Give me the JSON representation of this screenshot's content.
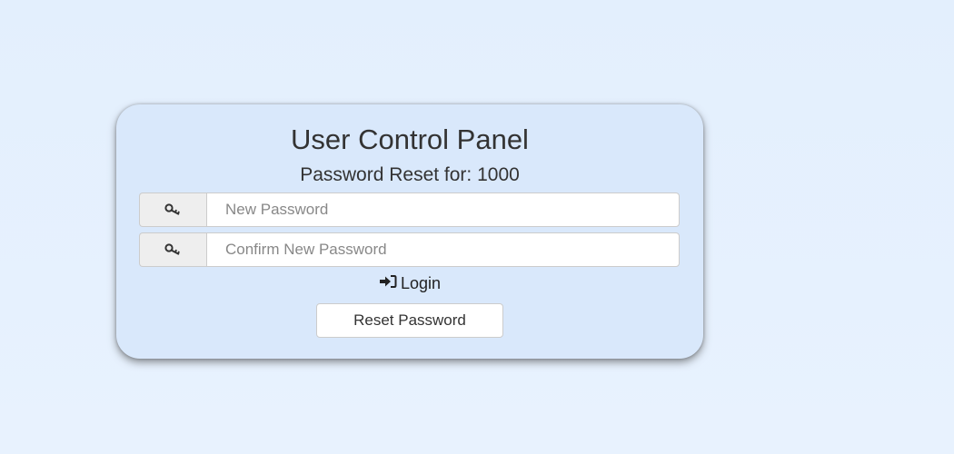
{
  "panel": {
    "title": "User Control Panel",
    "subtitle": "Password Reset for: 1000"
  },
  "form": {
    "new_password": {
      "icon": "key-icon",
      "placeholder": "New Password",
      "value": ""
    },
    "confirm_password": {
      "icon": "key-icon",
      "placeholder": "Confirm New Password",
      "value": ""
    },
    "login_link": {
      "icon": "sign-in-icon",
      "label": "Login"
    },
    "reset_button_label": "Reset Password"
  },
  "colors": {
    "background": "#e3effd",
    "panel": "#d9e8fb",
    "text": "#333333"
  }
}
